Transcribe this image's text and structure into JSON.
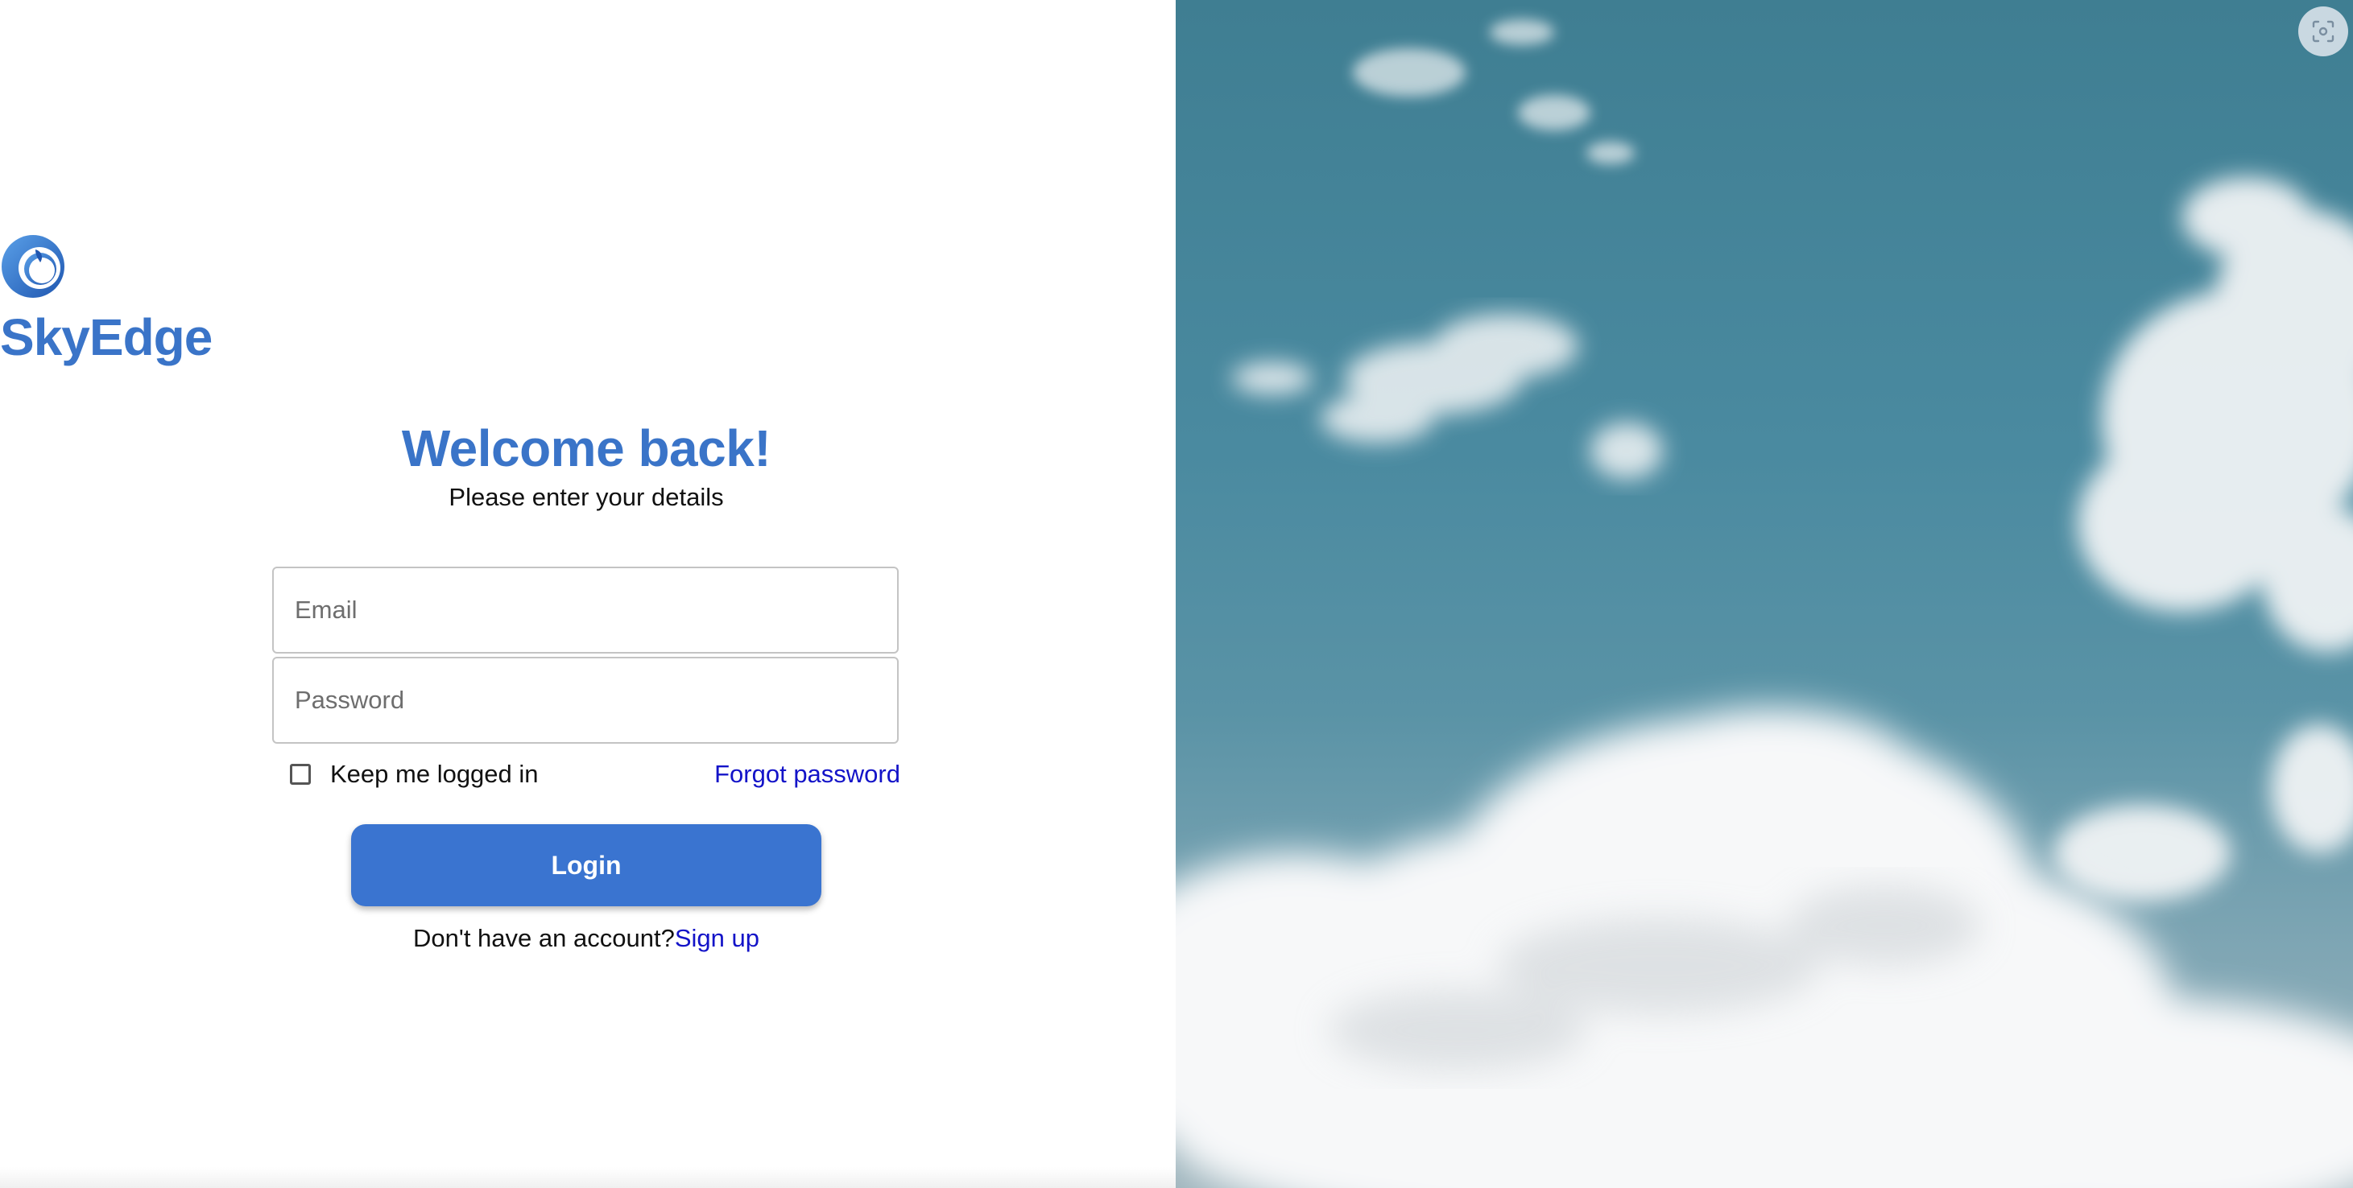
{
  "brand": {
    "name": "SkyEdge",
    "color": "#3a74c8"
  },
  "login": {
    "heading": "Welcome back!",
    "subheading": "Please enter your details",
    "email_placeholder": "Email",
    "password_placeholder": "Password",
    "remember_label": "Keep me logged in",
    "remember_checked": false,
    "forgot_label": "Forgot password",
    "login_label": "Login",
    "signup_prompt": "Don't have an account?",
    "signup_label": "Sign up"
  },
  "colors": {
    "accent": "#3a74d0",
    "link": "#1313c8",
    "sky": "#4a8aa0"
  },
  "icons": {
    "logo": "skyedge-logo-icon",
    "screen_capture": "screen-capture-icon"
  }
}
